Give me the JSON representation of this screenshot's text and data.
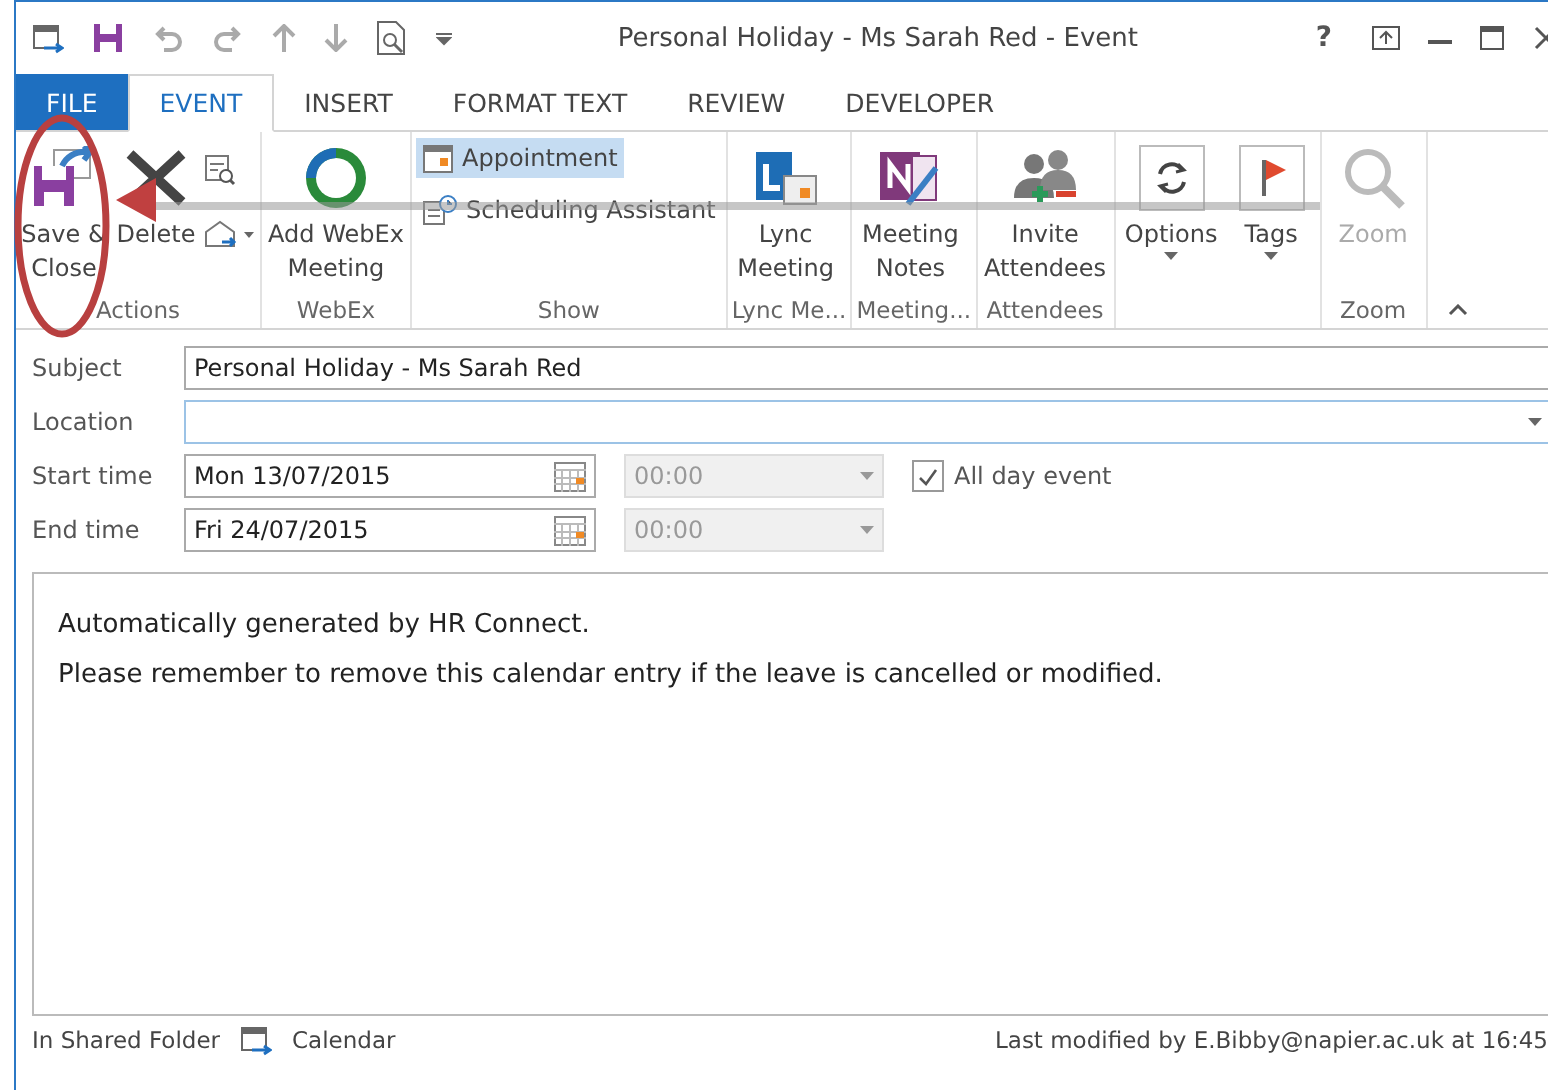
{
  "window": {
    "title": "Personal Holiday - Ms Sarah Red - Event",
    "help": "?"
  },
  "ribbon_tabs": [
    {
      "label": "FILE",
      "kind": "file",
      "selected": false
    },
    {
      "label": "EVENT",
      "kind": "tab",
      "selected": true
    },
    {
      "label": "INSERT",
      "kind": "tab",
      "selected": false
    },
    {
      "label": "FORMAT TEXT",
      "kind": "tab",
      "selected": false
    },
    {
      "label": "REVIEW",
      "kind": "tab",
      "selected": false
    },
    {
      "label": "DEVELOPER",
      "kind": "tab",
      "selected": false
    }
  ],
  "ribbon_groups": [
    {
      "label": "Actions",
      "items": [
        {
          "kind": "large",
          "label": "Save & Close"
        },
        {
          "kind": "large",
          "label": "Delete"
        },
        {
          "kind": "icons"
        }
      ]
    },
    {
      "label": "WebEx",
      "items": [
        {
          "kind": "large",
          "label": "Add WebEx Meeting"
        }
      ]
    },
    {
      "label": "Show",
      "items": [
        {
          "kind": "small",
          "label": "Appointment",
          "selected": true
        },
        {
          "kind": "small",
          "label": "Scheduling Assistant",
          "selected": false
        }
      ]
    },
    {
      "label": "Lync Me...",
      "items": [
        {
          "kind": "large",
          "label": "Lync Meeting"
        }
      ]
    },
    {
      "label": "Meeting...",
      "items": [
        {
          "kind": "large",
          "label": "Meeting Notes"
        }
      ]
    },
    {
      "label": "Attendees",
      "items": [
        {
          "kind": "large",
          "label": "Invite Attendees"
        }
      ]
    },
    {
      "items": [
        {
          "kind": "boxed",
          "label": "Options"
        },
        {
          "kind": "boxed",
          "label": "Tags"
        }
      ]
    },
    {
      "label": "Zoom",
      "items": [
        {
          "kind": "large",
          "label": "Zoom",
          "disabled": true
        }
      ]
    }
  ],
  "form": {
    "subject": {
      "label": "Subject",
      "value": "Personal Holiday - Ms Sarah Red"
    },
    "location": {
      "label": "Location"
    },
    "start": {
      "label": "Start time",
      "date": "Mon 13/07/2015",
      "time": "00:00"
    },
    "end": {
      "label": "End time",
      "date": "Fri 24/07/2015",
      "time": "00:00"
    },
    "all_day": {
      "label": "All day event",
      "checked": true
    }
  },
  "body": [
    "Automatically generated by HR Connect.",
    "Please remember to remove this calendar entry if the leave is cancelled or modified."
  ],
  "status_bar": {
    "folder": "In Shared Folder",
    "calendar": "Calendar",
    "modified": "Last modified by E.Bibby@napier.ac.uk at 16:45"
  }
}
